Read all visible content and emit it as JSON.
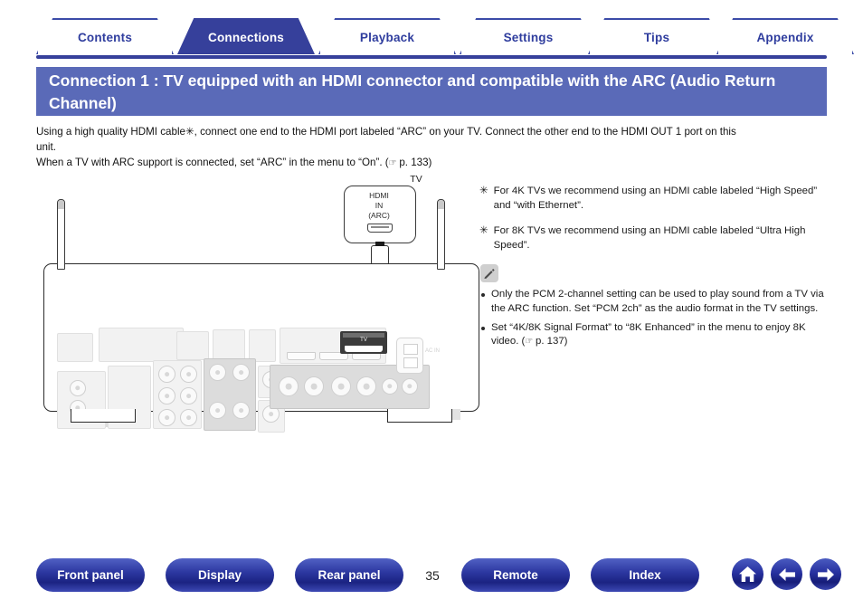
{
  "tabs": [
    {
      "label": "Contents",
      "active": false
    },
    {
      "label": "Connections",
      "active": true
    },
    {
      "label": "Playback",
      "active": false
    },
    {
      "label": "Settings",
      "active": false
    },
    {
      "label": "Tips",
      "active": false
    },
    {
      "label": "Appendix",
      "active": false
    }
  ],
  "title": "Connection 1 : TV equipped with an HDMI connector and compatible with the ARC (Audio Return Channel)",
  "intro": {
    "line1": "Using a high quality HDMI cable✳, connect one end to the HDMI port labeled “ARC” on your TV. Connect the other end to the HDMI OUT 1 port on this",
    "line2": "unit.",
    "line3_a": "When a TV with ARC support is connected, set “ARC” in the menu to “On”.  (",
    "line3_ref": "☞",
    "line3_b": " p. 133)"
  },
  "diagram": {
    "tv_label": "TV",
    "tv_port_line1": "HDMI",
    "tv_port_line2": "IN",
    "tv_port_line3": "(ARC)",
    "hdmi_out_label": "TV",
    "ac_in_label": "AC IN"
  },
  "notes": {
    "star_notes": [
      {
        "marker": "✳",
        "text": "For 4K TVs we recommend using an HDMI cable labeled “High Speed” and “with Ethernet”."
      },
      {
        "marker": "✳",
        "text": "For 8K TVs we recommend using an HDMI cable labeled “Ultra High Speed”."
      }
    ],
    "badge_icon": "pencil-icon",
    "bullets": [
      {
        "text": "Only the PCM 2-channel setting can be used to play sound from a TV via the ARC function. Set “PCM 2ch” as the audio format in the TV settings."
      },
      {
        "text_a": "Set “4K/8K Signal Format” to “8K Enhanced” in the menu to enjoy 8K video.  (",
        "ref": "☞",
        "text_b": " p. 137)"
      }
    ]
  },
  "bottom": {
    "buttons": [
      {
        "label": "Front panel"
      },
      {
        "label": "Display"
      },
      {
        "label": "Rear panel"
      },
      {
        "label": "Remote"
      },
      {
        "label": "Index"
      }
    ],
    "page_number": "35",
    "icons": [
      {
        "name": "home-icon"
      },
      {
        "name": "arrow-left-icon"
      },
      {
        "name": "arrow-right-icon"
      }
    ]
  },
  "colors": {
    "tab_active_bg": "#36409b",
    "tab_text": "#2f3d9e",
    "banner_bg": "#5a6ab8",
    "pill_blue": "#2c37a0"
  }
}
